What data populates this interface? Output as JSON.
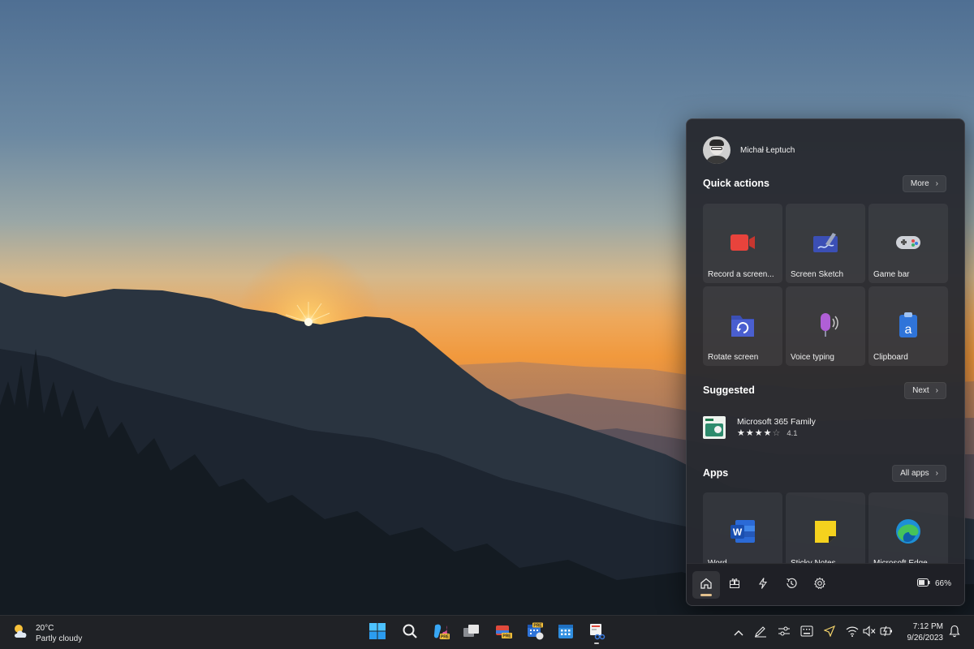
{
  "panel": {
    "profile": {
      "name": "Michał Łeptuch"
    },
    "quick_actions": {
      "title": "Quick actions",
      "more_label": "More",
      "tiles": [
        {
          "label": "Record a screen...",
          "icon": "record-icon"
        },
        {
          "label": "Screen Sketch",
          "icon": "screen-sketch-icon"
        },
        {
          "label": "Game bar",
          "icon": "gamepad-icon"
        },
        {
          "label": "Rotate screen",
          "icon": "rotate-screen-icon"
        },
        {
          "label": "Voice typing",
          "icon": "microphone-icon"
        },
        {
          "label": "Clipboard",
          "icon": "clipboard-icon"
        }
      ]
    },
    "suggested": {
      "title": "Suggested",
      "next_label": "Next",
      "item": {
        "name": "Microsoft 365 Family",
        "rating": "4.1",
        "stars": 4
      }
    },
    "apps": {
      "title": "Apps",
      "all_apps_label": "All apps",
      "tiles": [
        {
          "label": "Word",
          "icon": "word-icon"
        },
        {
          "label": "Sticky Notes",
          "icon": "sticky-notes-icon"
        },
        {
          "label": "Microsoft Edge",
          "icon": "edge-icon"
        }
      ]
    },
    "footer": {
      "nav": [
        "home-icon",
        "widgets-icon",
        "actions-icon",
        "history-icon",
        "gear-icon"
      ],
      "active": "home-icon",
      "battery": "66%"
    }
  },
  "taskbar": {
    "weather": {
      "temp": "20°C",
      "condition": "Partly cloudy"
    },
    "apps": [
      "start-icon",
      "search-icon",
      "copilot-icon",
      "task-view-icon",
      "store-icon",
      "calendar-app-icon",
      "calendar-icon",
      "snipping-tool-icon"
    ],
    "tray": [
      "chevron-up-icon",
      "pen-icon",
      "sliders-icon",
      "keyboard-icon",
      "location-icon",
      "wifi-icon",
      "volume-muted-icon",
      "battery-charging-icon"
    ],
    "clock": {
      "time": "7:12 PM",
      "date": "9/26/2023"
    }
  },
  "colors": {
    "accent": "#e2c08d",
    "panel_bg": "#282a30",
    "taskbar_bg": "#202226"
  }
}
